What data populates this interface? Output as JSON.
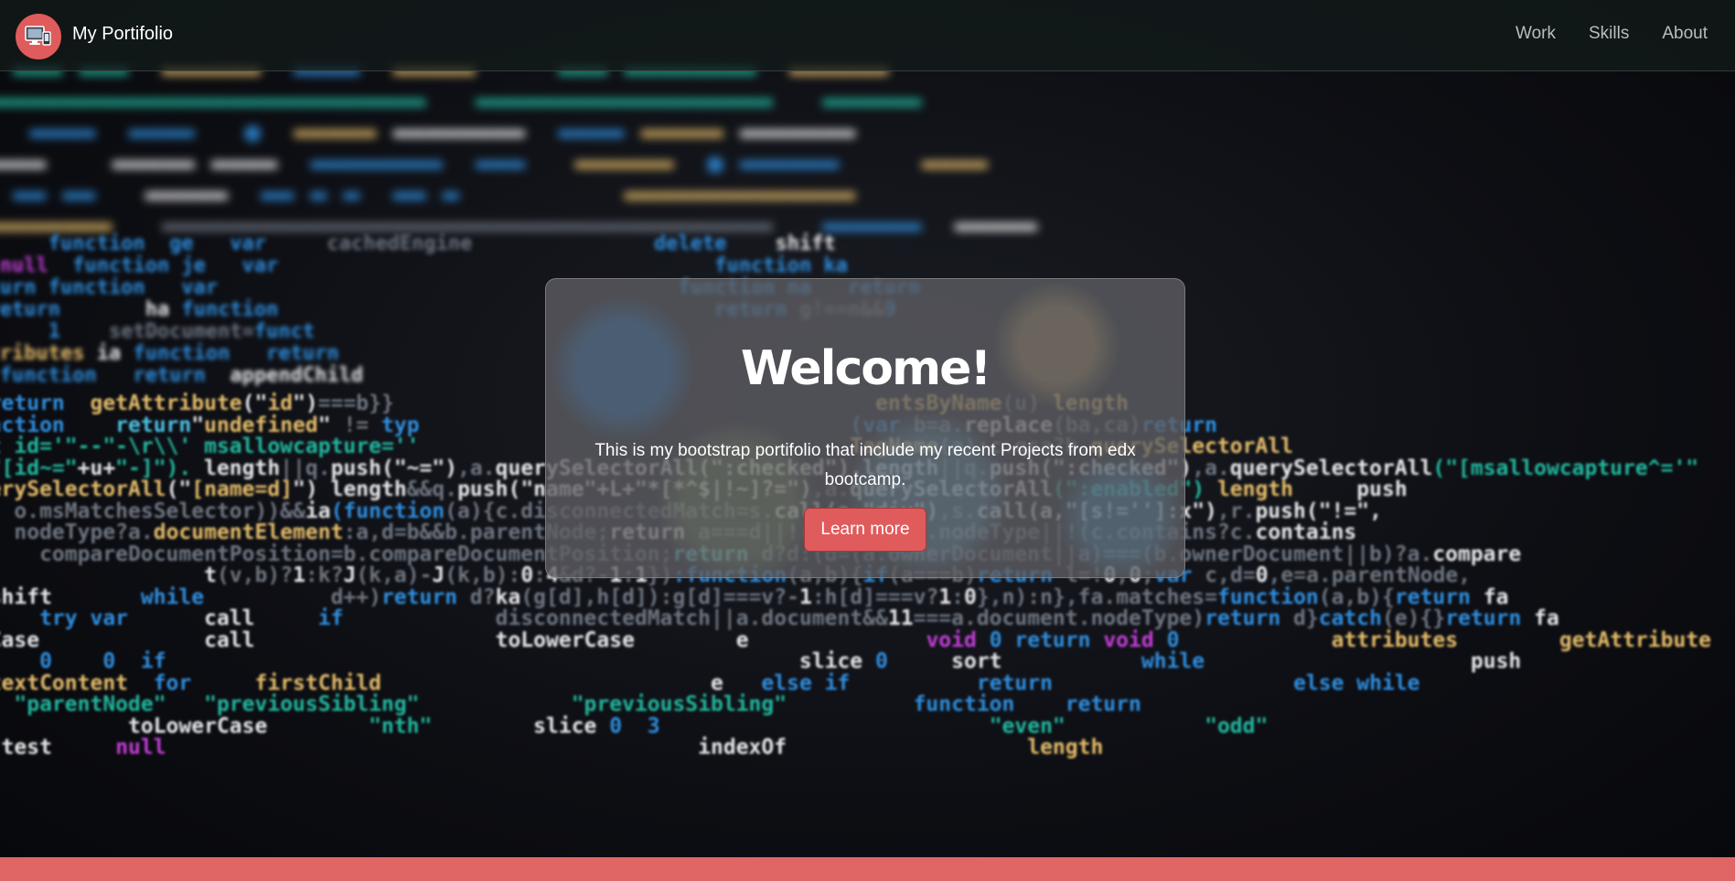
{
  "navbar": {
    "brand_name": "My Portifolio",
    "brand_icon": "computer-monitor-icon",
    "links": [
      "Work",
      "Skills",
      "About"
    ]
  },
  "hero": {
    "title": "Welcome!",
    "text": "This is my bootstrap portifolio that include my recent Projects from edx bootcamp.",
    "button_label": "Learn more"
  },
  "colors": {
    "accent": "#e05b5b",
    "footer": "#e06565"
  }
}
